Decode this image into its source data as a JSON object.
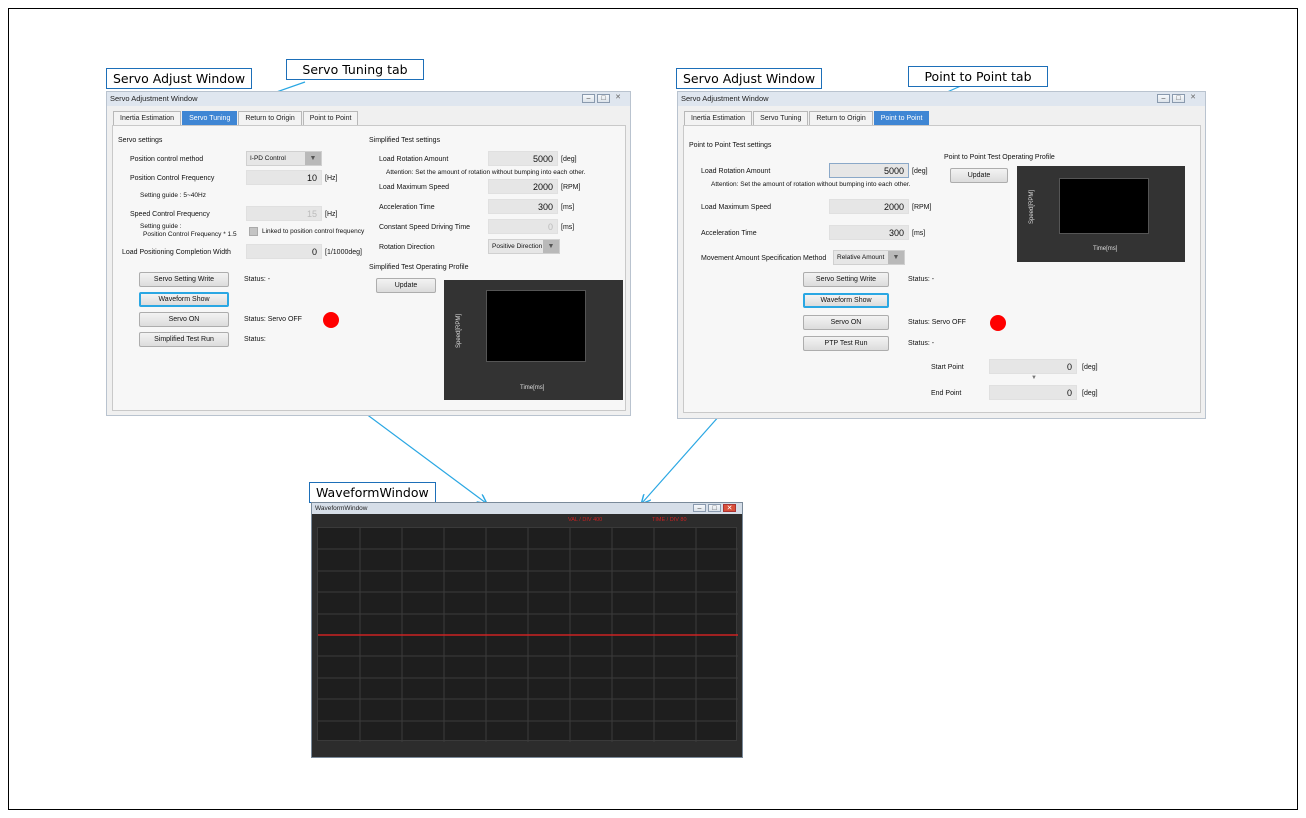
{
  "colors": {
    "accent_tab": "#3f86d4",
    "callout_border": "#1d6fb8",
    "connector": "#2aa7e3",
    "status_dot": "#ff0000",
    "waveform_line": "#cc2222"
  },
  "callouts": {
    "left_window": "Servo Adjust Window",
    "left_tab": "Servo Tuning tab",
    "right_window": "Servo Adjust Window",
    "right_tab": "Point to Point tab",
    "waveform": "WaveformWindow"
  },
  "win_left": {
    "title": "Servo Adjustment Window",
    "tabs": [
      "Inertia Estimation",
      "Servo Tuning",
      "Return to Origin",
      "Point to Point"
    ],
    "servo_settings": {
      "heading": "Servo settings",
      "pos_method_label": "Position control method",
      "pos_method_value": "I-PD Control",
      "pos_freq_label": "Position Control Frequency",
      "pos_freq_value": "10",
      "pos_freq_unit": "[Hz]",
      "guide1": "Setting guide : 5~40Hz",
      "speed_freq_label": "Speed Control Frequency",
      "speed_freq_value": "15",
      "speed_freq_unit": "[Hz]",
      "guide2_line1": "Setting guide :",
      "guide2_line2": "Position Control Frequency * 1.5",
      "linked_label": "Linked to position control frequency",
      "completion_label": "Load Positioning Completion Width",
      "completion_value": "0",
      "completion_unit": "[1/1000deg]"
    },
    "buttons": {
      "write": "Servo Setting Write",
      "waveform": "Waveform Show",
      "servo_on": "Servo ON",
      "test_run": "Simplified Test Run"
    },
    "status": {
      "write": "Status:  -",
      "servo_on": "Status:  Servo OFF",
      "test_run": "Status:"
    },
    "test_settings": {
      "heading": "Simplified Test settings",
      "rotation_label": "Load Rotation Amount",
      "rotation_value": "5000",
      "rotation_unit": "[deg]",
      "attention": "Attention: Set the amount of rotation without bumping into each other.",
      "max_speed_label": "Load Maximum Speed",
      "max_speed_value": "2000",
      "max_speed_unit": "[RPM]",
      "accel_label": "Acceleration Time",
      "accel_value": "300",
      "accel_unit": "[ms]",
      "const_label": "Constant Speed Driving Time",
      "const_value": "0",
      "const_unit": "[ms]",
      "direction_label": "Rotation Direction",
      "direction_value": "Positive Direction"
    },
    "profile": {
      "heading": "Simplified Test Operating Profile",
      "update": "Update",
      "ylabel": "Speed[RPM]",
      "xlabel": "Time[ms]"
    }
  },
  "win_right": {
    "title": "Servo Adjustment Window",
    "tabs": [
      "Inertia Estimation",
      "Servo Tuning",
      "Return to Origin",
      "Point to Point"
    ],
    "settings": {
      "heading": "Point to Point Test settings",
      "rotation_label": "Load Rotation Amount",
      "rotation_value": "5000",
      "rotation_unit": "[deg]",
      "attention": "Attention: Set the amount of rotation without bumping into each other.",
      "max_speed_label": "Load Maximum Speed",
      "max_speed_value": "2000",
      "max_speed_unit": "[RPM]",
      "accel_label": "Acceleration Time",
      "accel_value": "300",
      "accel_unit": "[ms]",
      "method_label": "Movement Amount Specification Method",
      "method_value": "Relative Amount"
    },
    "profile": {
      "heading": "Point to Point Test Operating Profile",
      "update": "Update",
      "ylabel": "Speed[RPM]",
      "xlabel": "Time[ms]"
    },
    "buttons": {
      "write": "Servo Setting Write",
      "waveform": "Waveform Show",
      "servo_on": "Servo ON",
      "test_run": "PTP Test Run"
    },
    "status": {
      "write": "Status:  -",
      "servo_on": "Status:  Servo OFF",
      "test_run": "Status:  -"
    },
    "points": {
      "start_label": "Start Point",
      "start_value": "0",
      "start_unit": "[deg]",
      "end_label": "End Point",
      "end_value": "0",
      "end_unit": "[deg]"
    }
  },
  "waveform": {
    "title": "WaveformWindow",
    "val_header": "VAL / DIV 400",
    "time_header": "TIME / DIV 80"
  }
}
